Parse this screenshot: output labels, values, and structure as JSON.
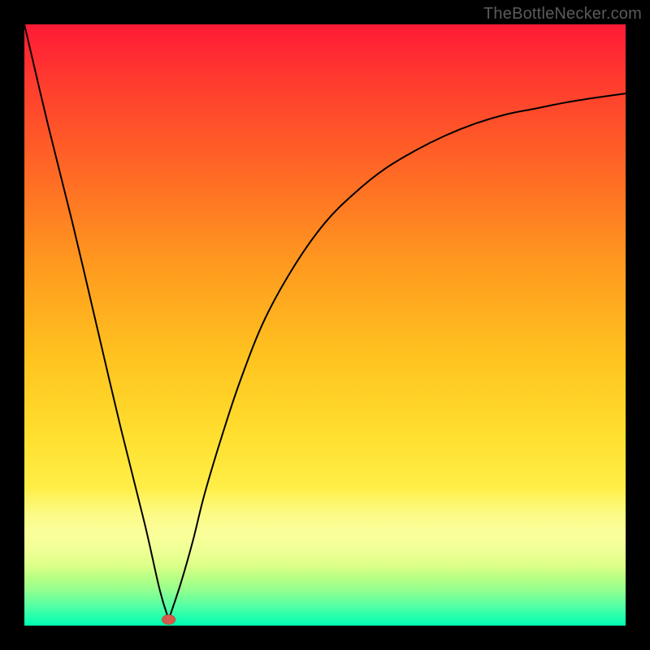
{
  "watermark": "TheBottleNecker.com",
  "chart_data": {
    "type": "line",
    "title": "",
    "xlabel": "",
    "ylabel": "",
    "xlim": [
      0,
      100
    ],
    "ylim": [
      0,
      100
    ],
    "grid": false,
    "marker": {
      "x": 24,
      "y": 1,
      "color": "#d65a4a"
    },
    "series": [
      {
        "name": "left-branch",
        "x": [
          0,
          4,
          8,
          12,
          16,
          20,
          22.5,
          24
        ],
        "values": [
          100,
          83,
          67,
          50,
          33,
          17,
          6,
          1
        ]
      },
      {
        "name": "right-branch",
        "x": [
          24,
          26,
          28,
          30,
          33,
          36,
          40,
          45,
          50,
          55,
          60,
          65,
          70,
          75,
          80,
          85,
          90,
          95,
          100
        ],
        "values": [
          1,
          7,
          14,
          22,
          32,
          41,
          51,
          60,
          67,
          72,
          76,
          79,
          81.5,
          83.5,
          85,
          86,
          87,
          87.8,
          88.5
        ]
      }
    ],
    "background_gradient": {
      "direction": "vertical",
      "stops": [
        {
          "pos": 0.0,
          "color": "#ff1a36"
        },
        {
          "pos": 0.25,
          "color": "#ff6a25"
        },
        {
          "pos": 0.55,
          "color": "#ffc21f"
        },
        {
          "pos": 0.8,
          "color": "#fff04a"
        },
        {
          "pos": 0.94,
          "color": "#96ff8e"
        },
        {
          "pos": 1.0,
          "color": "#00ffb0"
        }
      ]
    }
  }
}
